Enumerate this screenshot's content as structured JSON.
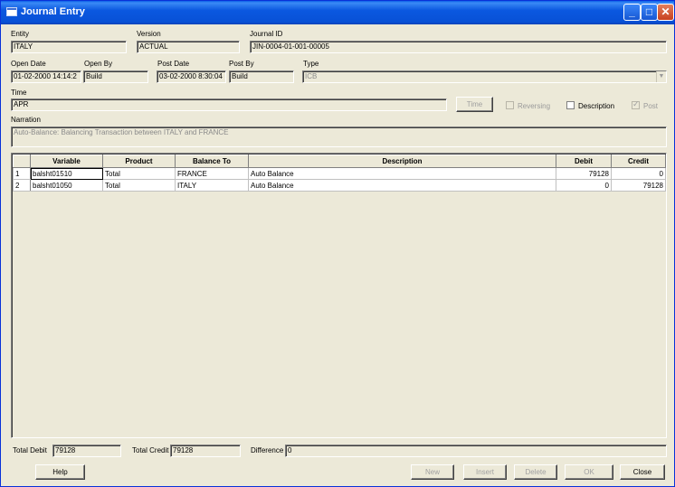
{
  "window": {
    "title": "Journal Entry"
  },
  "header": {
    "entity_label": "Entity",
    "entity_value": "ITALY",
    "version_label": "Version",
    "version_value": "ACTUAL",
    "journal_id_label": "Journal ID",
    "journal_id_value": "JIN-0004-01-001-00005",
    "open_date_label": "Open Date",
    "open_date_value": "01-02-2000  14:14:2",
    "open_by_label": "Open By",
    "open_by_value": "Build",
    "post_date_label": "Post Date",
    "post_date_value": "03-02-2000  8:30:04",
    "post_by_label": "Post By",
    "post_by_value": "Build",
    "type_label": "Type",
    "type_value": "ICB",
    "time_label": "Time",
    "time_value": "APR",
    "time_button": "Time",
    "reversing_label": "Reversing",
    "description_label": "Description",
    "post_label": "Post",
    "narration_label": "Narration",
    "narration_value": "Auto-Balance: Balancing Transaction between ITALY and FRANCE"
  },
  "grid": {
    "columns": [
      "Variable",
      "Product",
      "Balance To",
      "Description",
      "Debit",
      "Credit"
    ],
    "rows": [
      {
        "num": "1",
        "variable": "balsht01510",
        "product": "Total",
        "balance_to": "FRANCE",
        "description": "Auto Balance",
        "debit": "79128",
        "credit": "0"
      },
      {
        "num": "2",
        "variable": "balsht01050",
        "product": "Total",
        "balance_to": "ITALY",
        "description": "Auto Balance",
        "debit": "0",
        "credit": "79128"
      }
    ]
  },
  "totals": {
    "total_debit_label": "Total Debit",
    "total_debit_value": "79128",
    "total_credit_label": "Total Credit",
    "total_credit_value": "79128",
    "difference_label": "Difference",
    "difference_value": "0"
  },
  "buttons": {
    "help": "Help",
    "new": "New",
    "insert": "Insert",
    "delete": "Delete",
    "ok": "OK",
    "close": "Close"
  },
  "colors": {
    "titlebar": "#0a5ee8",
    "face": "#ece9d8"
  }
}
